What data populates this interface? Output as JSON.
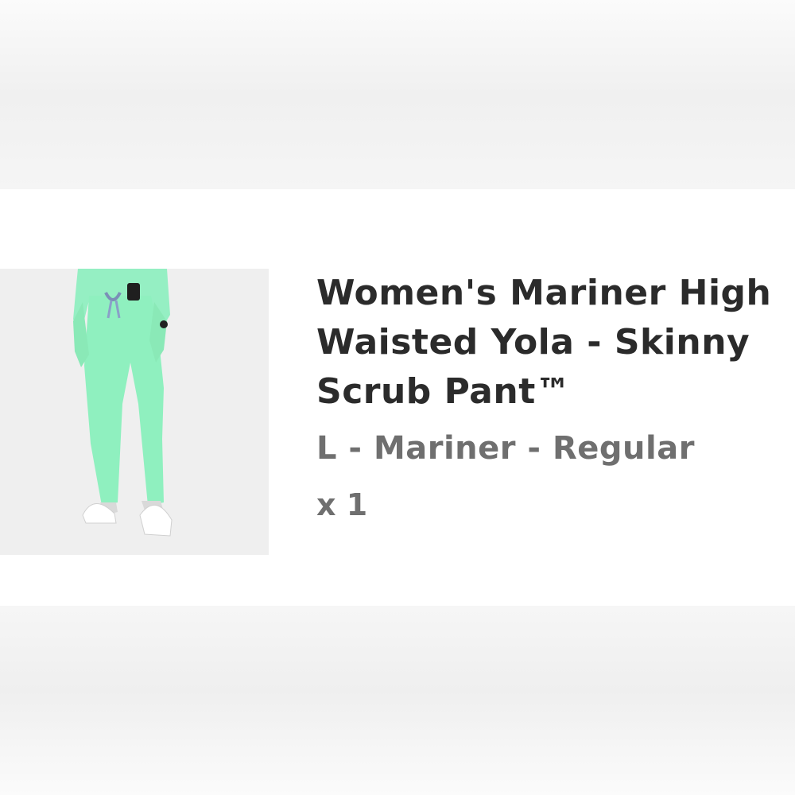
{
  "cart_item": {
    "title": "Women's Mariner High Waisted Yola - Skinny Scrub Pant™",
    "variant": "L - Mariner - Regular",
    "quantity": "x 1",
    "image_icon": "product-photo-scrub-pants",
    "colors": {
      "title": "#2b2b2b",
      "secondary": "#6f6f6f",
      "product": "#8ff0bf",
      "image_bg": "#efefef"
    }
  }
}
